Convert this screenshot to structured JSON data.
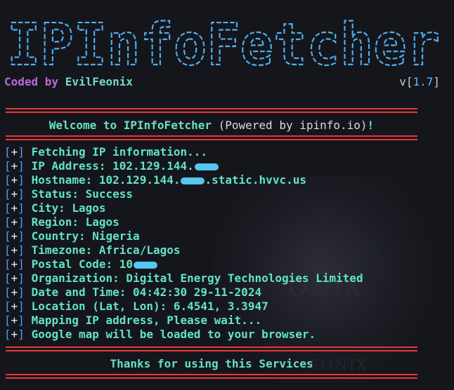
{
  "banner": {
    "title": "IPInfoFetcher"
  },
  "credit": {
    "prefix": "Coded by",
    "author": "EvilFeonix"
  },
  "version": {
    "prefix": "v[",
    "number": "1.7",
    "suffix": "]"
  },
  "welcome": {
    "lead": "Welcome to IPInfoFetcher",
    "powered": "(Powered by ipinfo.io)",
    "bang": "!"
  },
  "lines": [
    {
      "prefix": "[",
      "marker": "+",
      "suffix": "]",
      "text": "Fetching IP information..."
    },
    {
      "prefix": "[",
      "marker": "+",
      "suffix": "]",
      "text": "IP Address: 102.129.144."
    },
    {
      "prefix": "[",
      "marker": "+",
      "suffix": "]",
      "text": "Hostname: 102.129.144.",
      "tail": ".static.hvvc.us"
    },
    {
      "prefix": "[",
      "marker": "+",
      "suffix": "]",
      "text": "Status: Success"
    },
    {
      "prefix": "[",
      "marker": "+",
      "suffix": "]",
      "text": "City: Lagos"
    },
    {
      "prefix": "[",
      "marker": "+",
      "suffix": "]",
      "text": "Region: Lagos"
    },
    {
      "prefix": "[",
      "marker": "+",
      "suffix": "]",
      "text": "Country: Nigeria"
    },
    {
      "prefix": "[",
      "marker": "+",
      "suffix": "]",
      "text": "Timezone: Africa/Lagos"
    },
    {
      "prefix": "[",
      "marker": "+",
      "suffix": "]",
      "text": "Postal Code: 10"
    },
    {
      "prefix": "[",
      "marker": "+",
      "suffix": "]",
      "text": "Organization: Digital Energy Technologies Limited"
    },
    {
      "prefix": "[",
      "marker": "+",
      "suffix": "]",
      "text": "Date and Time: 04:42:30 29-11-2024"
    },
    {
      "prefix": "[",
      "marker": "+",
      "suffix": "]",
      "text": "Location (Lat, Lon): 6.4541, 3.3947"
    },
    {
      "prefix": "[",
      "marker": "+",
      "suffix": "]",
      "text": "Mapping IP address, Please wait..."
    },
    {
      "prefix": "[",
      "marker": "+",
      "suffix": "]",
      "text": "Google map will be loaded to your browser."
    }
  ],
  "thanks": "Thanks for using this Services",
  "watermark": {
    "big": "ONIX",
    "small": "FONIX"
  },
  "colors": {
    "background": "#15161c",
    "banner": "#4fb0f0",
    "credit": "#b86bdc",
    "accent_text": "#62e4c7",
    "bracket": "#4a9eff",
    "separator": "#e5383b",
    "redaction": "#55c6f0"
  },
  "icons": {
    "redaction": "redaction-blob"
  }
}
